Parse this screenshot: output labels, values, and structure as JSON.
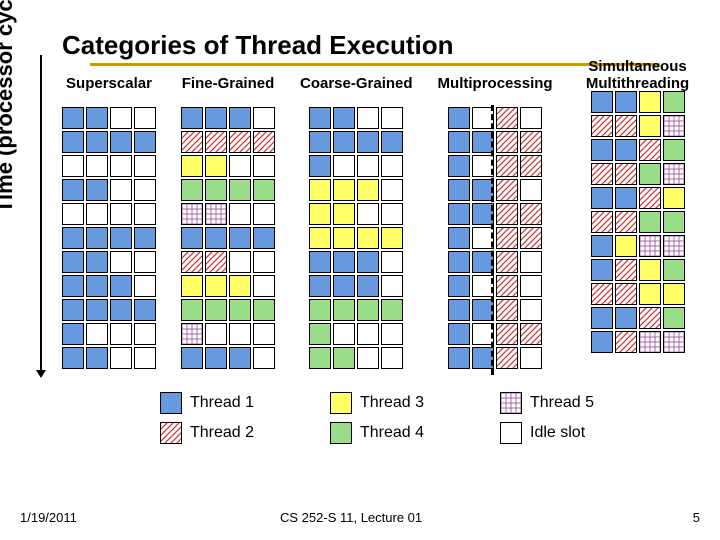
{
  "title": "Categories of Thread Execution",
  "y_axis": "Time (processor cycle)",
  "columns": [
    {
      "name": "Superscalar"
    },
    {
      "name": "Fine-Grained"
    },
    {
      "name": "Coarse-Grained"
    },
    {
      "name": "Multiprocessing"
    },
    {
      "name": "Simultaneous Multithreading"
    }
  ],
  "chart_data": {
    "type": "table",
    "rows": 11,
    "cols_per_grid": 4,
    "legend_map": {
      "0": "Idle slot",
      "1": "Thread 1",
      "2": "Thread 2",
      "3": "Thread 3",
      "4": "Thread 4",
      "5": "Thread 5"
    },
    "grids": {
      "Superscalar": [
        [
          1,
          1,
          0,
          0
        ],
        [
          1,
          1,
          1,
          1
        ],
        [
          0,
          0,
          0,
          0
        ],
        [
          1,
          1,
          0,
          0
        ],
        [
          0,
          0,
          0,
          0
        ],
        [
          1,
          1,
          1,
          1
        ],
        [
          1,
          1,
          0,
          0
        ],
        [
          1,
          1,
          1,
          0
        ],
        [
          1,
          1,
          1,
          1
        ],
        [
          1,
          0,
          0,
          0
        ],
        [
          1,
          1,
          0,
          0
        ]
      ],
      "Fine-Grained": [
        [
          1,
          1,
          1,
          0
        ],
        [
          2,
          2,
          2,
          2
        ],
        [
          3,
          3,
          0,
          0
        ],
        [
          4,
          4,
          4,
          4
        ],
        [
          5,
          5,
          0,
          0
        ],
        [
          1,
          1,
          1,
          1
        ],
        [
          2,
          2,
          0,
          0
        ],
        [
          3,
          3,
          3,
          0
        ],
        [
          4,
          4,
          4,
          4
        ],
        [
          5,
          0,
          0,
          0
        ],
        [
          1,
          1,
          1,
          0
        ]
      ],
      "Coarse-Grained": [
        [
          1,
          1,
          0,
          0
        ],
        [
          1,
          1,
          1,
          1
        ],
        [
          1,
          0,
          0,
          0
        ],
        [
          3,
          3,
          3,
          0
        ],
        [
          3,
          3,
          0,
          0
        ],
        [
          3,
          3,
          3,
          3
        ],
        [
          1,
          1,
          1,
          0
        ],
        [
          1,
          1,
          1,
          0
        ],
        [
          4,
          4,
          4,
          4
        ],
        [
          4,
          0,
          0,
          0
        ],
        [
          4,
          4,
          0,
          0
        ]
      ],
      "Multiprocessing": [
        [
          1,
          0,
          2,
          0
        ],
        [
          1,
          1,
          2,
          2
        ],
        [
          1,
          0,
          2,
          2
        ],
        [
          1,
          1,
          2,
          0
        ],
        [
          1,
          1,
          2,
          2
        ],
        [
          1,
          0,
          2,
          2
        ],
        [
          1,
          1,
          2,
          0
        ],
        [
          1,
          0,
          2,
          0
        ],
        [
          1,
          1,
          2,
          0
        ],
        [
          1,
          0,
          2,
          2
        ],
        [
          1,
          1,
          2,
          0
        ]
      ],
      "Simultaneous Multithreading": [
        [
          1,
          1,
          3,
          4
        ],
        [
          2,
          2,
          3,
          5
        ],
        [
          1,
          1,
          2,
          4
        ],
        [
          2,
          2,
          4,
          5
        ],
        [
          1,
          1,
          2,
          3
        ],
        [
          2,
          2,
          4,
          4
        ],
        [
          1,
          3,
          5,
          5
        ],
        [
          1,
          2,
          3,
          4
        ],
        [
          2,
          2,
          3,
          3
        ],
        [
          1,
          1,
          2,
          4
        ],
        [
          1,
          2,
          5,
          5
        ]
      ]
    }
  },
  "legend": [
    {
      "id": 1,
      "label": "Thread 1"
    },
    {
      "id": 3,
      "label": "Thread 3"
    },
    {
      "id": 5,
      "label": "Thread 5"
    },
    {
      "id": 2,
      "label": "Thread 2"
    },
    {
      "id": 4,
      "label": "Thread 4"
    },
    {
      "id": 0,
      "label": "Idle slot"
    }
  ],
  "colors": {
    "idle": "#ffffff",
    "t1": "#6699dd",
    "t3": "#ffff66",
    "t4": "#99dd88"
  },
  "footer": {
    "date": "1/19/2011",
    "center": "CS 252-S 11, Lecture 01",
    "page": "5"
  }
}
